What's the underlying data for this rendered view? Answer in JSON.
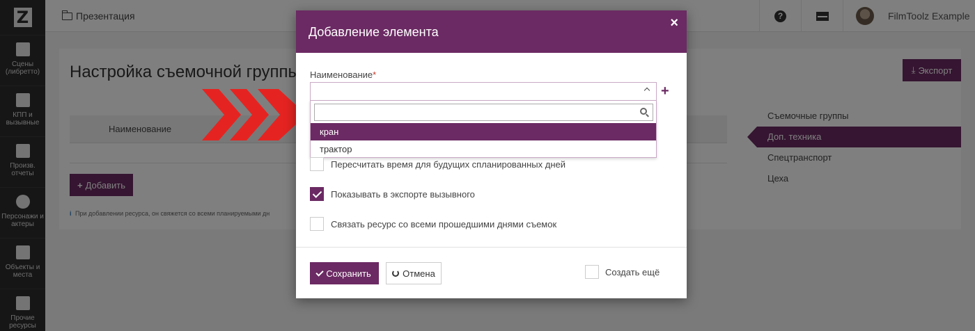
{
  "sidebar": {
    "logo": "Z",
    "items": [
      {
        "label": "Сцены (либретто)",
        "icon": "clapperboard-icon"
      },
      {
        "label": "КПП и вызывные",
        "icon": "calendar-icon"
      },
      {
        "label": "Произв. отчеты",
        "icon": "checkbox-icon"
      },
      {
        "label": "Персонажи и актеры",
        "icon": "users-icon"
      },
      {
        "label": "Объекты и места",
        "icon": "image-icon"
      },
      {
        "label": "Прочие ресурсы",
        "icon": "archive-icon"
      }
    ]
  },
  "topbar": {
    "breadcrumb": "Презентация",
    "user_name": "FilmToolz Example",
    "help": "?"
  },
  "page": {
    "title": "Настройка съемочной группы",
    "export_label": "Экспорт",
    "table_column": "Наименование",
    "add_label": "Добавить",
    "hint": "При добавлении ресурса, он свяжется со всеми планируемыми дн"
  },
  "right_nav": [
    {
      "label": "Съемочные группы",
      "active": false
    },
    {
      "label": "Доп. техника",
      "active": true
    },
    {
      "label": "Спецтранспорт",
      "active": false
    },
    {
      "label": "Цеха",
      "active": false
    }
  ],
  "modal": {
    "title": "Добавление элемента",
    "close": "×",
    "field_label": "Наименование",
    "required_mark": "*",
    "plus": "+",
    "search_value": "",
    "options": [
      "кран",
      "трактор"
    ],
    "checkboxes": [
      {
        "label": "Пересчитать время для будущих спланированных дней",
        "checked": false
      },
      {
        "label": "Показывать в экспорте вызывного",
        "checked": true
      },
      {
        "label": "Связать ресурс со всеми прошедшими днями съемок",
        "checked": false
      }
    ],
    "save_label": "Сохранить",
    "cancel_label": "Отмена",
    "create_more_label": "Создать ещё",
    "create_more_checked": false
  },
  "colors": {
    "brand": "#6b2a63",
    "sidebar": "#2c2c2c",
    "arrow": "#e52421"
  }
}
